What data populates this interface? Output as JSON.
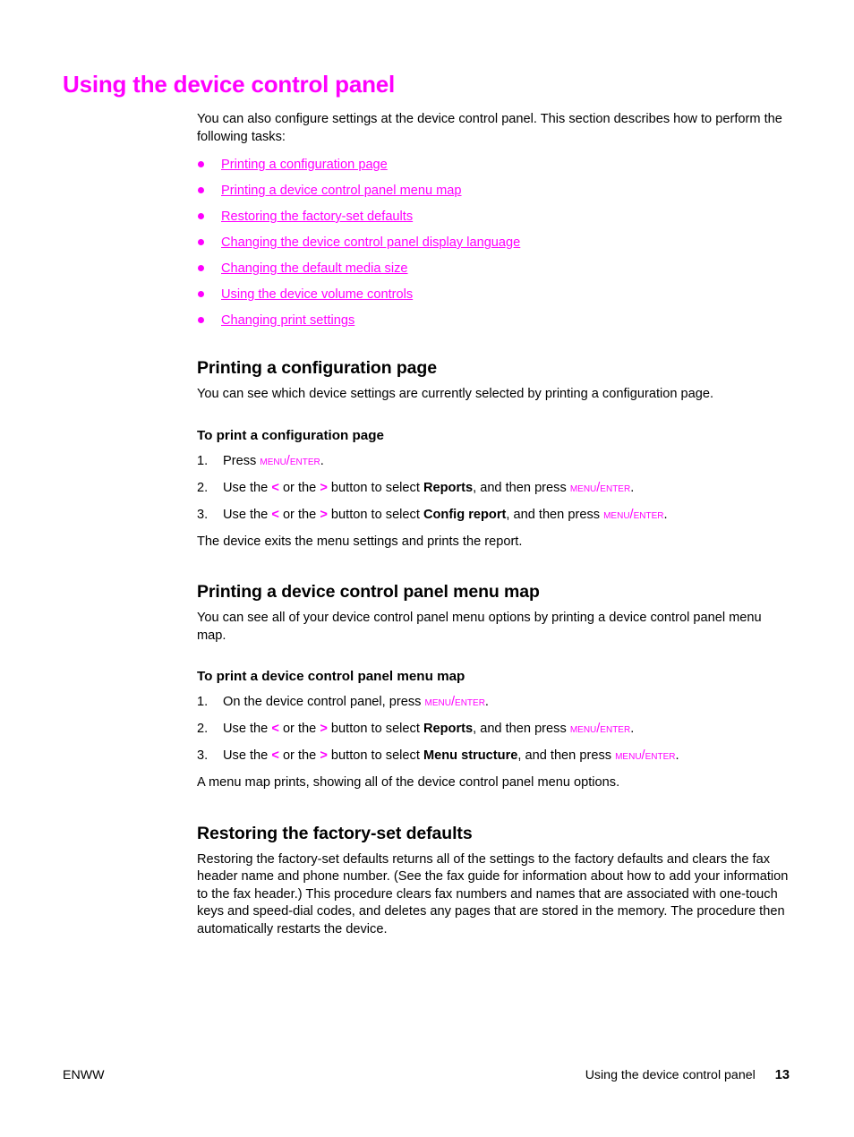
{
  "page": {
    "title": "Using the device control panel",
    "title_color": "#ff00ff",
    "link_color": "#ff00ff"
  },
  "intro": {
    "paragraph": "You can also configure settings at the device control panel. This section describes how to perform the following tasks:"
  },
  "link_list": [
    {
      "label": "Printing a configuration page"
    },
    {
      "label": "Printing a device control panel menu map"
    },
    {
      "label": "Restoring the factory-set defaults"
    },
    {
      "label": "Changing the device control panel display language"
    },
    {
      "label": "Changing the default media size"
    },
    {
      "label": "Using the device volume controls"
    },
    {
      "label": "Changing print settings"
    }
  ],
  "sections": [
    {
      "heading": "Printing a configuration page",
      "body": "You can see which device settings are currently selected by printing a configuration page.",
      "sub_heading": "To print a configuration page",
      "steps": [
        {
          "number": "1.",
          "parts": [
            {
              "type": "text",
              "value": "Press "
            },
            {
              "type": "key",
              "value": "Menu/Enter"
            },
            {
              "type": "text",
              "value": "."
            }
          ]
        },
        {
          "number": "2.",
          "parts": [
            {
              "type": "text",
              "value": "Use the "
            },
            {
              "type": "arrow",
              "value": "<"
            },
            {
              "type": "text",
              "value": " or the "
            },
            {
              "type": "arrow",
              "value": ">"
            },
            {
              "type": "text",
              "value": " button to select "
            },
            {
              "type": "bold",
              "value": "Reports"
            },
            {
              "type": "text",
              "value": ", and then press "
            },
            {
              "type": "key",
              "value": "Menu/Enter"
            },
            {
              "type": "text",
              "value": "."
            }
          ]
        },
        {
          "number": "3.",
          "parts": [
            {
              "type": "text",
              "value": "Use the "
            },
            {
              "type": "arrow",
              "value": "<"
            },
            {
              "type": "text",
              "value": " or the "
            },
            {
              "type": "arrow",
              "value": ">"
            },
            {
              "type": "text",
              "value": " button to select "
            },
            {
              "type": "bold",
              "value": "Config report"
            },
            {
              "type": "text",
              "value": ", and then press "
            },
            {
              "type": "key",
              "value": "Menu/Enter"
            },
            {
              "type": "text",
              "value": "."
            }
          ]
        }
      ],
      "closing": "The device exits the menu settings and prints the report."
    },
    {
      "heading": "Printing a device control panel menu map",
      "body": "You can see all of your device control panel menu options by printing a device control panel menu map.",
      "sub_heading": "To print a device control panel menu map",
      "steps": [
        {
          "number": "1.",
          "parts": [
            {
              "type": "text",
              "value": "On the device control panel, press "
            },
            {
              "type": "key",
              "value": "Menu/Enter"
            },
            {
              "type": "text",
              "value": "."
            }
          ]
        },
        {
          "number": "2.",
          "parts": [
            {
              "type": "text",
              "value": "Use the "
            },
            {
              "type": "arrow",
              "value": "<"
            },
            {
              "type": "text",
              "value": " or the "
            },
            {
              "type": "arrow",
              "value": ">"
            },
            {
              "type": "text",
              "value": " button to select "
            },
            {
              "type": "bold",
              "value": "Reports"
            },
            {
              "type": "text",
              "value": ", and then press "
            },
            {
              "type": "key",
              "value": "Menu/Enter"
            },
            {
              "type": "text",
              "value": "."
            }
          ]
        },
        {
          "number": "3.",
          "parts": [
            {
              "type": "text",
              "value": "Use the "
            },
            {
              "type": "arrow",
              "value": "<"
            },
            {
              "type": "text",
              "value": " or the "
            },
            {
              "type": "arrow",
              "value": ">"
            },
            {
              "type": "text",
              "value": " button to select "
            },
            {
              "type": "bold",
              "value": "Menu structure"
            },
            {
              "type": "text",
              "value": ", and then press "
            },
            {
              "type": "key",
              "value": "Menu/Enter"
            },
            {
              "type": "text",
              "value": "."
            }
          ]
        }
      ],
      "closing": "A menu map prints, showing all of the device control panel menu options."
    },
    {
      "heading": "Restoring the factory-set defaults",
      "body": "Restoring the factory-set defaults returns all of the settings to the factory defaults and clears the fax header name and phone number. (See the fax guide for information about how to add your information to the fax header.) This procedure clears fax numbers and names that are associated with one-touch keys and speed-dial codes, and deletes any pages that are stored in the memory. The procedure then automatically restarts the device.",
      "sub_heading": null,
      "steps": [],
      "closing": null
    }
  ],
  "footer": {
    "left": "ENWW",
    "right": "Using the device control panel",
    "page_number": "13"
  }
}
